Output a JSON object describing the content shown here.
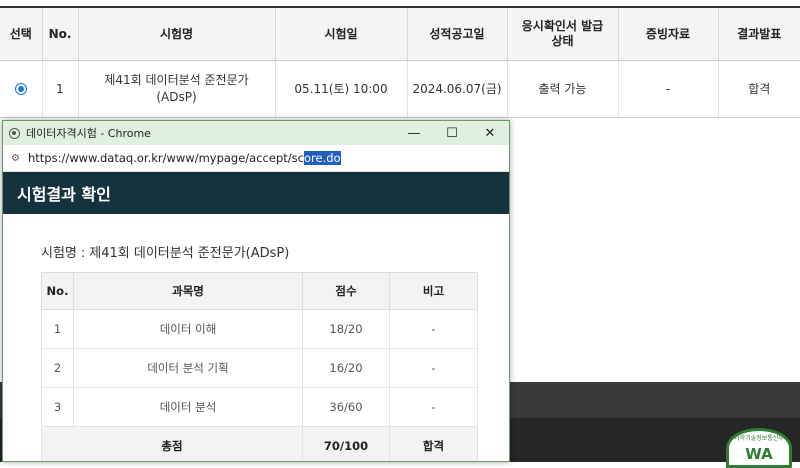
{
  "exam_list": {
    "headers": [
      "선택",
      "No.",
      "시험명",
      "시험일",
      "성적공고일",
      "응시확인서 발급상태",
      "증빙자료",
      "결과발표"
    ],
    "rows": [
      {
        "selected": true,
        "no": "1",
        "name": "제41회 데이터분석 준전문가 (ADsP)",
        "date": "05.11(토) 10:00",
        "announce_date": "2024.06.07(금)",
        "cert_status": "출력 가능",
        "evidence": "-",
        "result": "합격"
      }
    ]
  },
  "popup": {
    "window_title": "데이터자격시험 - Chrome",
    "url_before": "https://www.dataq.or.kr/www/mypage/accept/sc",
    "url_selected": "ore.do",
    "header": "시험결과 확인",
    "exam_label": "시험명",
    "exam_name": "제41회 데이터분석 준전문가(ADsP)",
    "table": {
      "headers": [
        "No.",
        "과목명",
        "점수",
        "비고"
      ],
      "rows": [
        {
          "no": "1",
          "subject": "데이터 이해",
          "score": "18/20",
          "note": "-"
        },
        {
          "no": "2",
          "subject": "데이터 분석 기획",
          "score": "16/20",
          "note": "-"
        },
        {
          "no": "3",
          "subject": "데이터 분석",
          "score": "36/60",
          "note": "-"
        }
      ],
      "total": {
        "label": "총점",
        "score": "70/100",
        "result": "합격"
      }
    },
    "buttons": {
      "minimize": "—",
      "maximize": "☐",
      "close": "✕"
    }
  },
  "footer": {
    "logo_text": "WA",
    "logo_caption": "과학기술정보통신부"
  },
  "colors": {
    "popup_header": "#15323f",
    "titlebar": "#dff0df",
    "radio": "#1a73e8",
    "logo_green": "#2e7d32"
  }
}
